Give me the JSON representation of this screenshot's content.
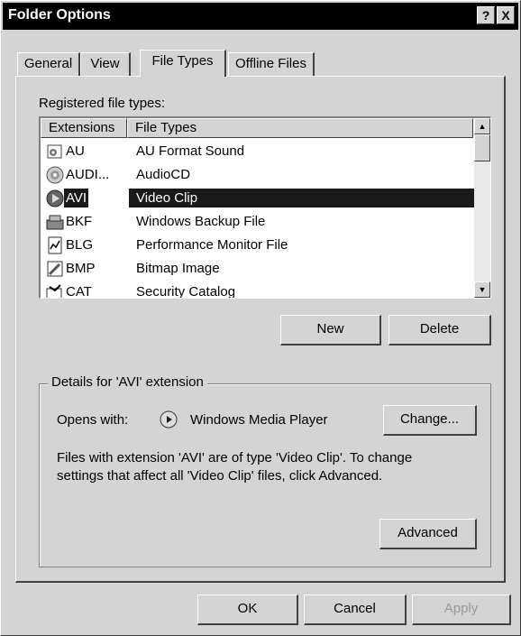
{
  "window": {
    "title": "Folder Options"
  },
  "titlebar_buttons": {
    "help": "?",
    "close": "X"
  },
  "tabs": [
    {
      "label": "General",
      "active": false
    },
    {
      "label": "View",
      "active": false
    },
    {
      "label": "File Types",
      "active": true
    },
    {
      "label": "Offline Files",
      "active": false
    }
  ],
  "registered_label": "Registered file types:",
  "list": {
    "headers": {
      "ext": "Extensions",
      "type": "File Types"
    },
    "rows": [
      {
        "ext": "AU",
        "type": "AU Format Sound",
        "icon": "sound-file-icon"
      },
      {
        "ext": "AUDI...",
        "type": "AudioCD",
        "icon": "cd-audio-icon"
      },
      {
        "ext": "AVI",
        "type": "Video Clip",
        "icon": "video-clip-icon",
        "selected": true
      },
      {
        "ext": "BKF",
        "type": "Windows Backup File",
        "icon": "backup-file-icon"
      },
      {
        "ext": "BLG",
        "type": "Performance Monitor File",
        "icon": "performance-log-icon"
      },
      {
        "ext": "BMP",
        "type": "Bitmap Image",
        "icon": "bitmap-image-icon"
      },
      {
        "ext": "CAT",
        "type": "Security Catalog",
        "icon": "security-catalog-icon"
      }
    ]
  },
  "buttons": {
    "new": "New",
    "delete": "Delete",
    "change": "Change...",
    "advanced": "Advanced",
    "ok": "OK",
    "cancel": "Cancel",
    "apply": "Apply"
  },
  "details": {
    "legend": "Details for 'AVI' extension",
    "opens_with_label": "Opens with:",
    "opens_with_app": "Windows Media Player",
    "description_line1": "Files with extension 'AVI' are of type 'Video Clip'.  To change",
    "description_line2": "settings that affect all 'Video Clip' files, click Advanced."
  },
  "colors": {
    "face": "#d4d4d4",
    "selection": "#1a1a1a",
    "titlebar": "#000000"
  }
}
